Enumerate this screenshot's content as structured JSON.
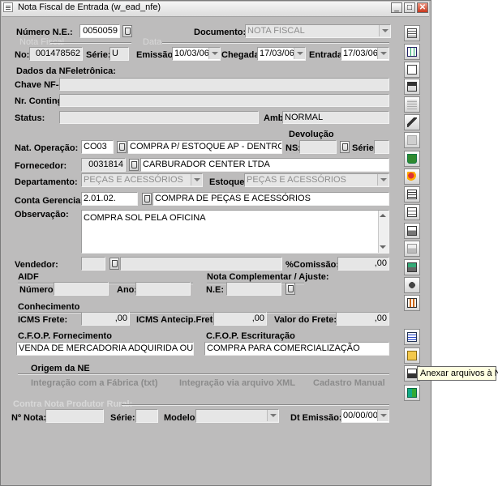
{
  "window": {
    "title": "Nota Fiscal de Entrada (w_ead_nfe)",
    "minimize": "_",
    "maximize": "□",
    "close": "✕"
  },
  "header": {
    "numero_label": "Número N.E.:",
    "numero_value": "0050059",
    "documento_label": "Documento:",
    "documento_value": "NOTA FISCAL",
    "nota_fiscal_caption": "Nota Fiscal",
    "data_caption": "Data",
    "no_label": "No:",
    "no_value": "001478562",
    "serie_label": "Série:",
    "serie_value": "U",
    "emissao_label": "Emissão:",
    "emissao_value": "10/03/06",
    "chegada_label": "Chegada:",
    "chegada_value": "17/03/06",
    "entrada_label": "Entrada:",
    "entrada_value": "17/03/06"
  },
  "nfe": {
    "section_label": "Dados da NFeletrônica:",
    "chave_label": "Chave NF-e:",
    "chave_value": "",
    "conting_label": "Nr. Conting.:",
    "conting_value": "",
    "status_label": "Status:",
    "status_value": "",
    "ambiente_label": "Ambiente:",
    "ambiente_value": "NORMAL"
  },
  "operacao": {
    "nat_label": "Nat. Operação:",
    "nat_code": "CO03",
    "nat_desc": "COMPRA P/ ESTOQUE AP - DENTRO EST",
    "devolucao_caption": "Devolução",
    "ns_label": "NS:",
    "ns_value": "",
    "serie_label": "Série:",
    "serie_value": "",
    "fornecedor_label": "Fornecedor:",
    "fornecedor_code": "0031814",
    "fornecedor_name": "CARBURADOR  CENTER  LTDA",
    "departamento_label": "Departamento:",
    "departamento_value": "PEÇAS E ACESSÓRIOS",
    "estoque_label": "Estoque:",
    "estoque_value": "PEÇAS E ACESSÓRIOS",
    "conta_label": "Conta Gerencial:",
    "conta_code": "2.01.02.",
    "conta_desc": "COMPRA DE PEÇAS E ACESSÓRIOS",
    "observacao_label": "Observação:",
    "observacao_value": "COMPRA SOL PELA OFICINA",
    "vendedor_label": "Vendedor:",
    "vendedor_code": "",
    "vendedor_name": "",
    "comissao_label": "%Comissão:",
    "comissao_value": ",00"
  },
  "aidf": {
    "caption": "AIDF",
    "numero_label": "Número:",
    "numero_value": "",
    "ano_label": "Ano:",
    "ano_value": "",
    "complementar_caption": "Nota Complementar / Ajuste:",
    "ne_label": "N.E:",
    "ne_value": ""
  },
  "conhecimento": {
    "caption": "Conhecimento",
    "icms_label": "ICMS Frete:",
    "icms_value": ",00",
    "icms_antecip_label": "ICMS Antecip.Frete:",
    "icms_antecip_value": ",00",
    "valor_label": "Valor do Frete:",
    "valor_value": ",00"
  },
  "cfop": {
    "fornecimento_caption": "C.F.O.P. Fornecimento",
    "fornecimento_value": "VENDA DE MERCADORIA ADQUIRIDA OU RE",
    "escrituracao_caption": "C.F.O.P. Escrituração",
    "escrituracao_value": "COMPRA PARA COMERCIALIZAÇÃO"
  },
  "origem": {
    "caption": "Origem da NE",
    "fabrica": "Integração com a Fábrica (txt)",
    "xml": "Integração via arquivo XML",
    "manual": "Cadastro Manual"
  },
  "produtor": {
    "caption": "Contra Nota Produtor Rural:",
    "nota_label": "Nº Nota:",
    "nota_value": "",
    "serie_label": "Série:",
    "serie_value": "",
    "modelo_label": "Modelo:",
    "modelo_value": "",
    "dt_label": "Dt Emissão:",
    "dt_value": "00/00/00"
  },
  "toolbar": {
    "tooltip": "Anexar arquivos à NE",
    "buttons": [
      "grid-icon",
      "table-add-icon",
      "document-icon",
      "printer-setup-icon",
      "list-disabled-icon",
      "lightning-icon",
      "blank-icon",
      "trash-icon",
      "people-icon",
      "form-edit-icon",
      "form-check-icon",
      "print-icon",
      "print-disabled-icon",
      "import-icon",
      "hand-icon",
      "calculator-icon",
      "attach-list-icon",
      "folder-open-icon",
      "attach-files-icon",
      "exit-icon"
    ]
  },
  "colors": {
    "window_bg": "#bdbcbc",
    "field_bg": "#e6e6e6",
    "tooltip_bg": "#ffffe1"
  }
}
